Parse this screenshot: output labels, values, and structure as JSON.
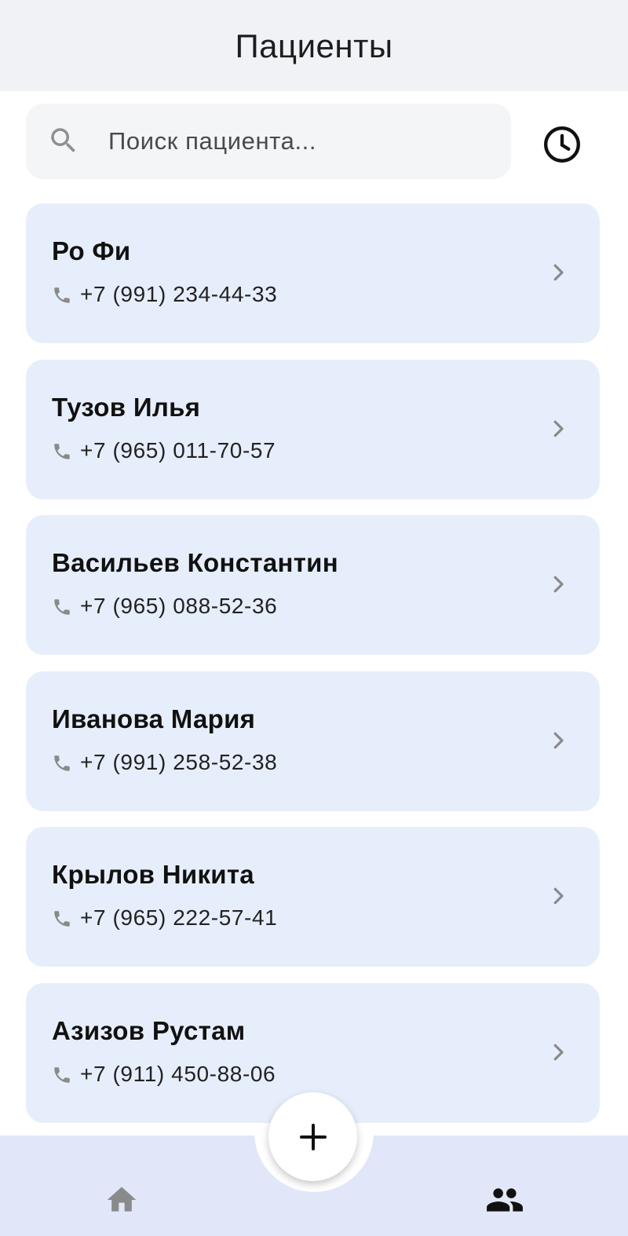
{
  "header": {
    "title": "Пациенты"
  },
  "search": {
    "placeholder": "Поиск пациента...",
    "value": "",
    "icon": "search-icon",
    "history_icon": "clock-icon"
  },
  "patients": [
    {
      "name": "Ро Фи",
      "phone": "+7 (991) 234-44-33"
    },
    {
      "name": "Тузов Илья",
      "phone": "+7 (965) 011-70-57"
    },
    {
      "name": "Васильев Константин",
      "phone": "+7 (965) 088-52-36"
    },
    {
      "name": "Иванова Мария",
      "phone": "+7 (991) 258-52-38"
    },
    {
      "name": "Крылов Никита",
      "phone": "+7 (965) 222-57-41"
    },
    {
      "name": "Азизов Рустам",
      "phone": "+7 (911) 450-88-06"
    }
  ],
  "bottom_nav": {
    "items": [
      {
        "icon": "home-icon",
        "active": false
      },
      {
        "icon": "people-icon",
        "active": true
      }
    ],
    "fab_icon": "plus-icon"
  },
  "colors": {
    "header_bg": "#f0f2f5",
    "card_bg": "#e7eefb",
    "search_bg": "#f4f5f7",
    "bottom_bar_bg": "#e1e7f8",
    "inactive_icon": "#8a8a8a",
    "active_icon": "#111111"
  }
}
